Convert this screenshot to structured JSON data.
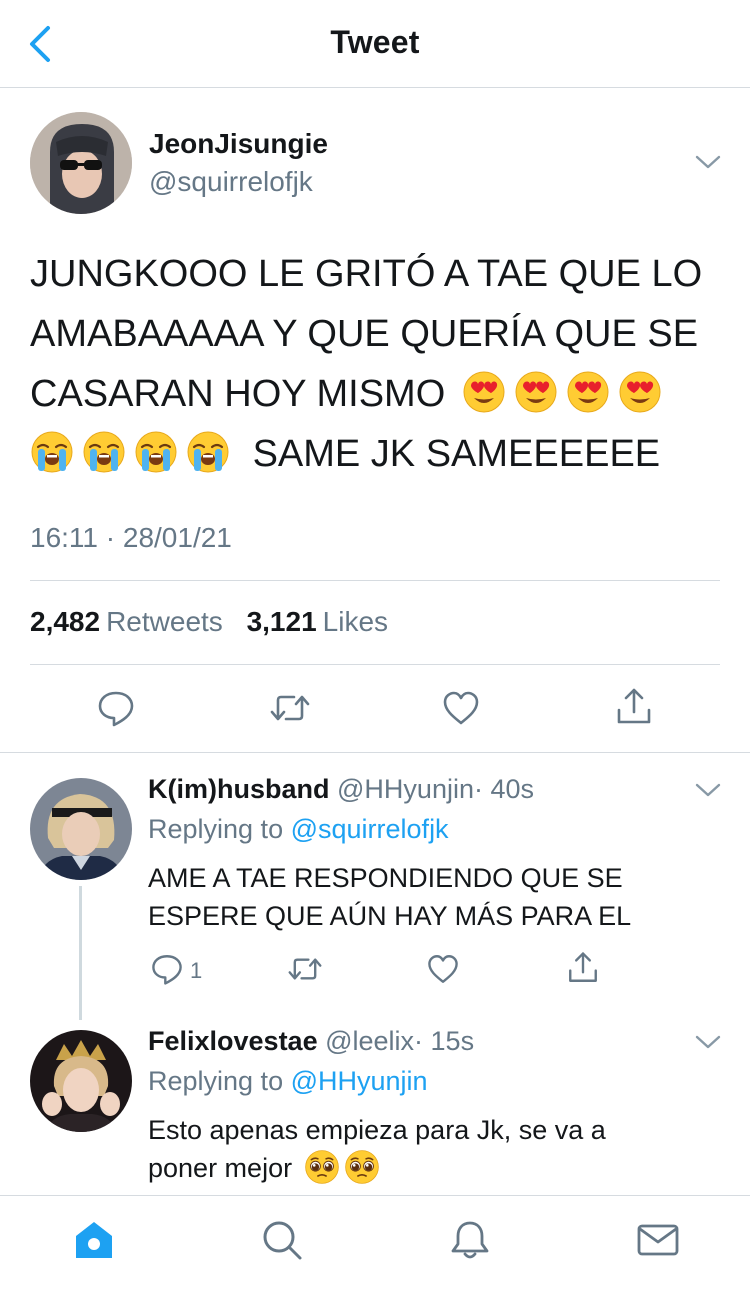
{
  "header": {
    "title": "Tweet",
    "back_icon": "chevron-left-icon"
  },
  "tweet": {
    "author_name": "JeonJisungie",
    "handle": "@squirrelofjk",
    "text_line1": "JUNGKOOO LE GRITÓ A TAE QUE LO",
    "text_line2": "AMABAAAAA Y QUE QUERÍA QUE SE",
    "text_line3": "CASARAN HOY MISMO",
    "text_line4": "SAME JK SAMEEEEEE",
    "timestamp": "16:11 · 28/01/21",
    "retweets_count": "2,482",
    "retweets_label": "Retweets",
    "likes_count": "3,121",
    "likes_label": "Likes",
    "emojis": [
      "heart-eyes-emoji",
      "loudly-crying-emoji"
    ]
  },
  "replies": [
    {
      "name": "K(im)husband",
      "handle": "@HHyunjin",
      "time": "· 40s",
      "replying_label": "Replying to",
      "replying_to": "@squirrelofjk",
      "text_line1": "AME A TAE RESPONDIENDO QUE SE",
      "text_line2": "ESPERE QUE AÚN HAY MÁS PARA EL",
      "reply_count": "1"
    },
    {
      "name": "Felixlovestae",
      "handle": "@leelix",
      "time": "· 15s",
      "replying_label": "Replying to",
      "replying_to": "@HHyunjin",
      "text_line1": "Esto apenas empieza para Jk, se va a",
      "text_line2": "poner mejor",
      "emoji": "pleading-face-emoji"
    }
  ],
  "tabbar": {
    "items": [
      "home-icon",
      "search-icon",
      "bell-icon",
      "mail-icon"
    ],
    "active": "home-icon"
  },
  "colors": {
    "accent": "#1da1f2",
    "secondary_text": "#657786",
    "divider": "#d6dbe0"
  }
}
